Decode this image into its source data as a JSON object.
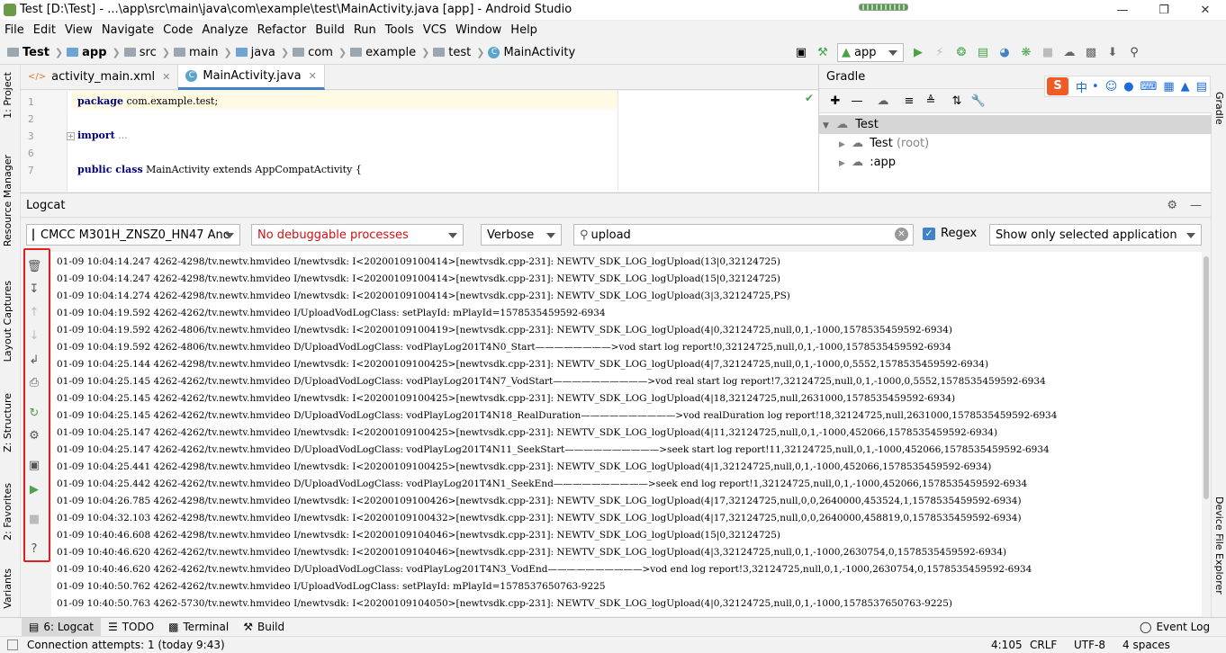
{
  "window": {
    "title": "Test [D:\\Test] - ...\\app\\src\\main\\java\\com\\example\\test\\MainActivity.java [app] - Android Studio"
  },
  "menu": [
    "File",
    "Edit",
    "View",
    "Navigate",
    "Code",
    "Analyze",
    "Refactor",
    "Build",
    "Run",
    "Tools",
    "VCS",
    "Window",
    "Help"
  ],
  "breadcrumbs": [
    "Test",
    "app",
    "src",
    "main",
    "java",
    "com",
    "example",
    "test",
    "MainActivity"
  ],
  "toolbar": {
    "run_config": "app"
  },
  "left_tabs": {
    "project": "1: Project",
    "resource_manager": "Resource Manager",
    "layout_captures": "Layout Captures",
    "structure": "Z: Structure",
    "favorites": "2: Favorites",
    "variants": "Variants"
  },
  "right_tabs": {
    "gradle": "Gradle",
    "device_explorer": "Device File Explorer"
  },
  "editor": {
    "tabs": [
      "activity_main.xml",
      "MainActivity.java"
    ],
    "lines": [
      {
        "num": "1",
        "kw": "package",
        "text": " com.example.test;"
      },
      {
        "num": "2",
        "kw": "",
        "text": ""
      },
      {
        "num": "3",
        "kw": "import",
        "text": " ..."
      },
      {
        "num": "6",
        "kw": "",
        "text": ""
      },
      {
        "num": "7",
        "kw": "public class",
        "text": " MainActivity extends AppCompatActivity {"
      }
    ]
  },
  "gradle": {
    "title": "Gradle",
    "root": "Test",
    "items": [
      {
        "label": "Test",
        "note": "(root)"
      },
      {
        "label": ":app",
        "note": ""
      }
    ]
  },
  "logcat": {
    "title": "Logcat",
    "device": "CMCC M301H_ZNSZ0_HN47 Anc",
    "process": "No debuggable processes",
    "level": "Verbose",
    "search": "upload",
    "regex_label": "Regex",
    "filter": "Show only selected application",
    "lines": [
      "01-09 10:04:14.247 4262-4298/tv.newtv.hmvideo I/newtvsdk: I<20200109100414>[newtvsdk.cpp-231]: NEWTV_SDK_LOG_logUpload(13|0,32124725)",
      "01-09 10:04:14.247 4262-4298/tv.newtv.hmvideo I/newtvsdk: I<20200109100414>[newtvsdk.cpp-231]: NEWTV_SDK_LOG_logUpload(15|0,32124725)",
      "01-09 10:04:14.274 4262-4298/tv.newtv.hmvideo I/newtvsdk: I<20200109100414>[newtvsdk.cpp-231]: NEWTV_SDK_LOG_logUpload(3|3,32124725,PS)",
      "01-09 10:04:19.592 4262-4262/tv.newtv.hmvideo I/UploadVodLogClass: setPlayId: mPlayId=1578535459592-6934",
      "01-09 10:04:19.592 4262-4806/tv.newtv.hmvideo I/newtvsdk: I<20200109100419>[newtvsdk.cpp-231]: NEWTV_SDK_LOG_logUpload(4|0,32124725,null,0,1,-1000,1578535459592-6934)",
      "01-09 10:04:19.592 4262-4806/tv.newtv.hmvideo D/UploadVodLogClass: vodPlayLog201T4N0_Start————————>vod start log report!0,32124725,null,0,1,-1000,1578535459592-6934",
      "01-09 10:04:25.144 4262-4298/tv.newtv.hmvideo I/newtvsdk: I<20200109100425>[newtvsdk.cpp-231]: NEWTV_SDK_LOG_logUpload(4|7,32124725,null,0,1,-1000,0,5552,1578535459592-6934)",
      "01-09 10:04:25.145 4262-4262/tv.newtv.hmvideo D/UploadVodLogClass: vodPlayLog201T4N7_VodStart——————————>vod real start log report!7,32124725,null,0,1,-1000,0,5552,1578535459592-6934",
      "01-09 10:04:25.145 4262-4262/tv.newtv.hmvideo I/newtvsdk: I<20200109100425>[newtvsdk.cpp-231]: NEWTV_SDK_LOG_logUpload(4|18,32124725,null,2631000,1578535459592-6934)",
      "01-09 10:04:25.145 4262-4262/tv.newtv.hmvideo D/UploadVodLogClass: vodPlayLog201T4N18_RealDuration——————————>vod realDuration log report!18,32124725,null,2631000,1578535459592-6934",
      "01-09 10:04:25.147 4262-4262/tv.newtv.hmvideo I/newtvsdk: I<20200109100425>[newtvsdk.cpp-231]: NEWTV_SDK_LOG_logUpload(4|11,32124725,null,0,1,-1000,452066,1578535459592-6934)",
      "01-09 10:04:25.147 4262-4262/tv.newtv.hmvideo D/UploadVodLogClass: vodPlayLog201T4N11_SeekStart——————————>seek start log report!11,32124725,null,0,1,-1000,452066,1578535459592-6934",
      "01-09 10:04:25.441 4262-4298/tv.newtv.hmvideo I/newtvsdk: I<20200109100425>[newtvsdk.cpp-231]: NEWTV_SDK_LOG_logUpload(4|1,32124725,null,0,1,-1000,452066,1578535459592-6934)",
      "01-09 10:04:25.442 4262-4262/tv.newtv.hmvideo D/UploadVodLogClass: vodPlayLog201T4N1_SeekEnd——————————>seek end log report!1,32124725,null,0,1,-1000,452066,1578535459592-6934",
      "01-09 10:04:26.785 4262-4298/tv.newtv.hmvideo I/newtvsdk: I<20200109100426>[newtvsdk.cpp-231]: NEWTV_SDK_LOG_logUpload(4|17,32124725,null,0,0,2640000,453524,1,1578535459592-6934)",
      "01-09 10:04:32.103 4262-4298/tv.newtv.hmvideo I/newtvsdk: I<20200109100432>[newtvsdk.cpp-231]: NEWTV_SDK_LOG_logUpload(4|17,32124725,null,0,0,2640000,458819,0,1578535459592-6934)",
      "01-09 10:40:46.608 4262-4298/tv.newtv.hmvideo I/newtvsdk: I<20200109104046>[newtvsdk.cpp-231]: NEWTV_SDK_LOG_logUpload(15|0,32124725)",
      "01-09 10:40:46.620 4262-4262/tv.newtv.hmvideo I/newtvsdk: I<20200109104046>[newtvsdk.cpp-231]: NEWTV_SDK_LOG_logUpload(4|3,32124725,null,0,1,-1000,2630754,0,1578535459592-6934)",
      "01-09 10:40:46.620 4262-4262/tv.newtv.hmvideo D/UploadVodLogClass: vodPlayLog201T4N3_VodEnd——————————>vod end log report!3,32124725,null,0,1,-1000,2630754,0,1578535459592-6934",
      "01-09 10:40:50.762 4262-4262/tv.newtv.hmvideo I/UploadVodLogClass: setPlayId: mPlayId=1578537650763-9225",
      "01-09 10:40:50.763 4262-5730/tv.newtv.hmvideo I/newtvsdk: I<20200109104050>[newtvsdk.cpp-231]: NEWTV_SDK_LOG_logUpload(4|0,32124725,null,0,1,-1000,1578537650763-9225)"
    ]
  },
  "bottom_tabs": [
    "6: Logcat",
    "TODO",
    "Terminal",
    "Build"
  ],
  "event_log": "Event Log",
  "status": {
    "message": "Connection attempts: 1 (today 9:43)",
    "position": "4:105",
    "line_sep": "CRLF",
    "encoding": "UTF-8",
    "indent": "4 spaces"
  },
  "colors": {
    "accent": "#4083c9",
    "highlight_box": "#e02020",
    "run_green": "#4aa34a"
  }
}
